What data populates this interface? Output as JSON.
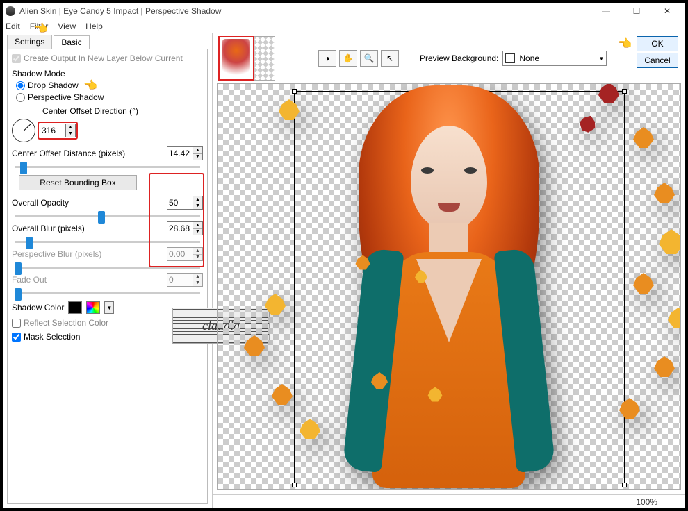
{
  "window": {
    "title": "Alien Skin | Eye Candy 5 Impact | Perspective Shadow"
  },
  "menu": {
    "edit": "Edit",
    "filter": "Filter",
    "view": "View",
    "help": "Help"
  },
  "tabs": {
    "settings": "Settings",
    "basic": "Basic"
  },
  "create_output_label": "Create Output In New Layer Below Current",
  "shadow_mode": {
    "group_label": "Shadow Mode",
    "drop": "Drop Shadow",
    "perspective": "Perspective Shadow"
  },
  "center_offset_direction_label": "Center Offset Direction (°)",
  "center_offset_direction_value": "316",
  "center_offset_distance_label": "Center Offset Distance (pixels)",
  "center_offset_distance_value": "14.42",
  "reset_bbox_label": "Reset Bounding Box",
  "overall_opacity_label": "Overall Opacity",
  "overall_opacity_value": "50",
  "overall_blur_label": "Overall Blur (pixels)",
  "overall_blur_value": "28.68",
  "perspective_blur_label": "Perspective Blur (pixels)",
  "perspective_blur_value": "0.00",
  "fade_out_label": "Fade Out",
  "fade_out_value": "0",
  "shadow_color_label": "Shadow Color",
  "reflect_selection_label": "Reflect Selection Color",
  "mask_selection_label": "Mask Selection",
  "preview_bg_label": "Preview Background:",
  "preview_bg_value": "None",
  "buttons": {
    "ok": "OK",
    "cancel": "Cancel"
  },
  "status": {
    "zoom": "100%"
  },
  "watermark": "claudia"
}
